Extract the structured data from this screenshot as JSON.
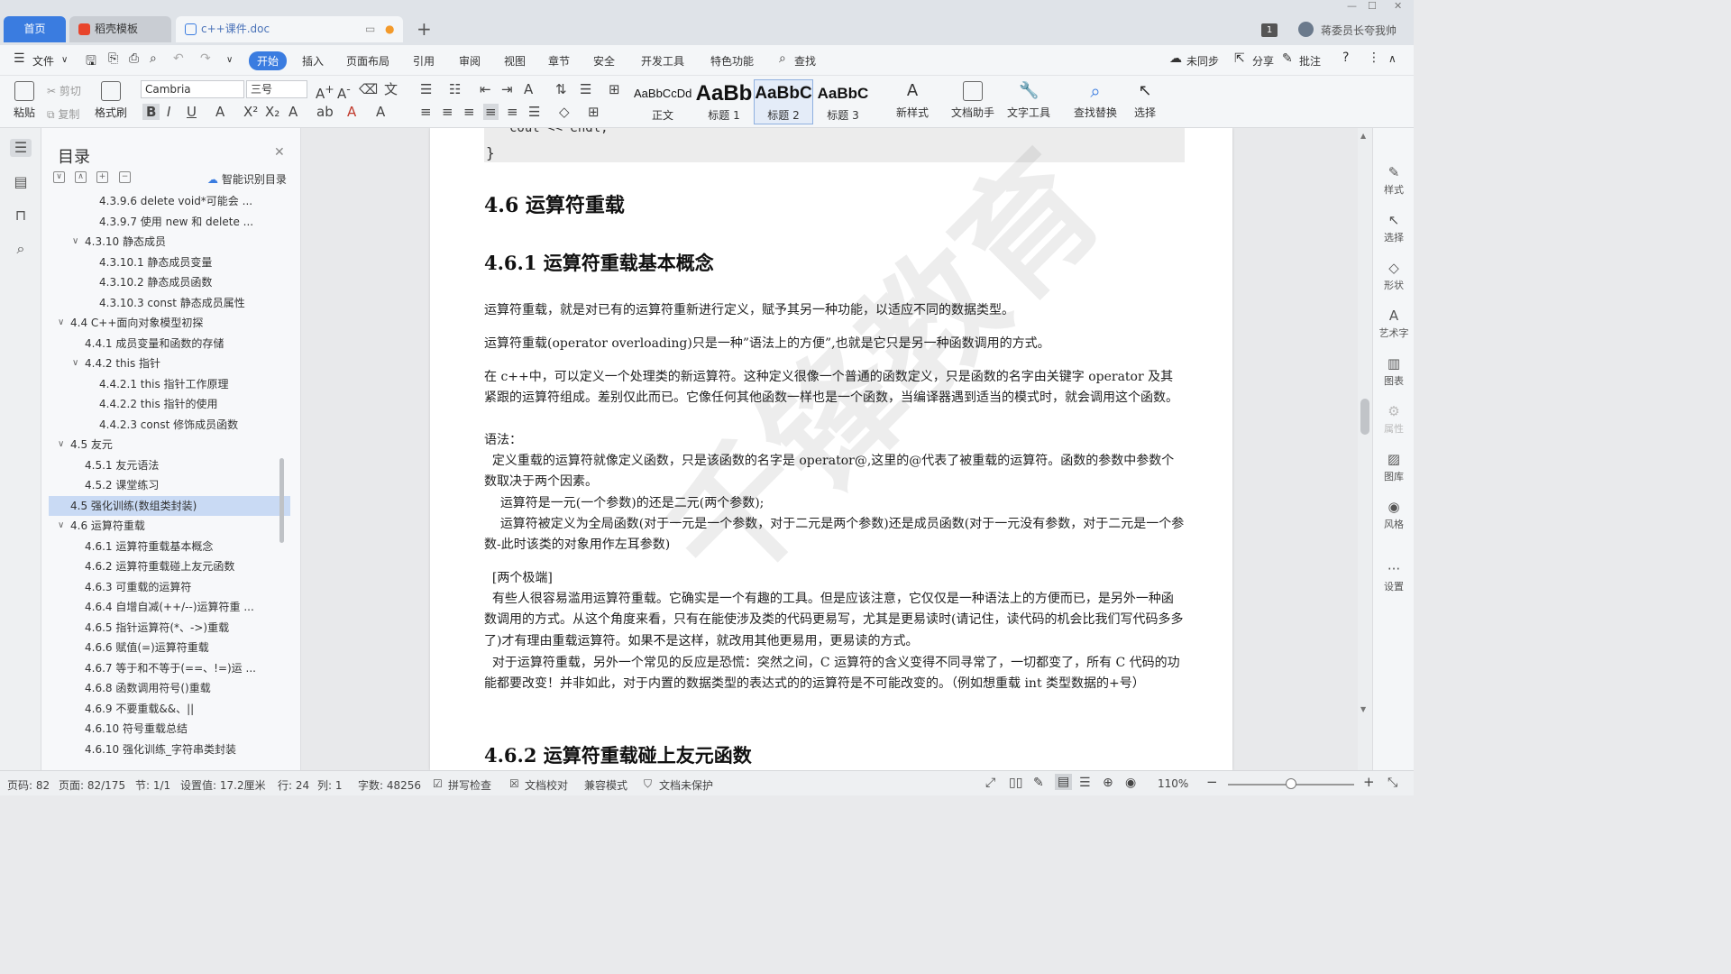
{
  "tabs": {
    "home": "首页",
    "template": "稻壳模板",
    "document": "c++课件.doc"
  },
  "titlebar": {
    "user": "蒋委员长夸我帅",
    "badge": "1"
  },
  "menu": {
    "file": "文件",
    "items": [
      "开始",
      "插入",
      "页面布局",
      "引用",
      "审阅",
      "视图",
      "章节",
      "安全",
      "开发工具",
      "特色功能"
    ],
    "search": "查找",
    "right": [
      "未同步",
      "分享",
      "批注"
    ]
  },
  "ribbon": {
    "paste": "粘贴",
    "cut": "剪切",
    "copy": "复制",
    "format_painter": "格式刷",
    "font_name": "Cambria",
    "font_size": "三号",
    "styles": [
      {
        "preview": "AaBbCcDd",
        "label": "正文"
      },
      {
        "preview": "AaBb",
        "label": "标题 1"
      },
      {
        "preview": "AaBbC",
        "label": "标题 2"
      },
      {
        "preview": "AaBbC",
        "label": "标题 3"
      }
    ],
    "new_style": "新样式",
    "doc_assistant": "文档助手",
    "text_tools": "文字工具",
    "find_replace": "查找替换",
    "select": "选择"
  },
  "toc": {
    "title": "目录",
    "smart": "智能识别目录",
    "items": [
      {
        "text": "4.3.9.6 delete void*可能会 ...",
        "indent": 3,
        "toggle": ""
      },
      {
        "text": "4.3.9.7 使用 new 和 delete ...",
        "indent": 3,
        "toggle": ""
      },
      {
        "text": "4.3.10 静态成员",
        "indent": 2,
        "toggle": "∨"
      },
      {
        "text": "4.3.10.1 静态成员变量",
        "indent": 3,
        "toggle": ""
      },
      {
        "text": "4.3.10.2 静态成员函数",
        "indent": 3,
        "toggle": ""
      },
      {
        "text": "4.3.10.3 const 静态成员属性",
        "indent": 3,
        "toggle": ""
      },
      {
        "text": "4.4 C++面向对象模型初探",
        "indent": 1,
        "toggle": "∨"
      },
      {
        "text": "4.4.1 成员变量和函数的存储",
        "indent": 2,
        "toggle": ""
      },
      {
        "text": "4.4.2 this 指针",
        "indent": 2,
        "toggle": "∨"
      },
      {
        "text": "4.4.2.1 this 指针工作原理",
        "indent": 3,
        "toggle": ""
      },
      {
        "text": "4.4.2.2 this 指针的使用",
        "indent": 3,
        "toggle": ""
      },
      {
        "text": "4.4.2.3 const 修饰成员函数",
        "indent": 3,
        "toggle": ""
      },
      {
        "text": "4.5 友元",
        "indent": 1,
        "toggle": "∨"
      },
      {
        "text": "4.5.1 友元语法",
        "indent": 2,
        "toggle": ""
      },
      {
        "text": "4.5.2 课堂练习",
        "indent": 2,
        "toggle": ""
      },
      {
        "text": "4.5 强化训练(数组类封装)",
        "indent": 1,
        "toggle": "",
        "selected": true
      },
      {
        "text": "4.6 运算符重载",
        "indent": 1,
        "toggle": "∨"
      },
      {
        "text": "4.6.1 运算符重载基本概念",
        "indent": 2,
        "toggle": ""
      },
      {
        "text": "4.6.2 运算符重载碰上友元函数",
        "indent": 2,
        "toggle": ""
      },
      {
        "text": "4.6.3 可重载的运算符",
        "indent": 2,
        "toggle": ""
      },
      {
        "text": "4.6.4 自增自减(++/--)运算符重 ...",
        "indent": 2,
        "toggle": ""
      },
      {
        "text": "4.6.5 指针运算符(*、->)重载",
        "indent": 2,
        "toggle": ""
      },
      {
        "text": "4.6.6 赋值(=)运算符重载",
        "indent": 2,
        "toggle": ""
      },
      {
        "text": "4.6.7 等于和不等于(==、!=)运 ...",
        "indent": 2,
        "toggle": ""
      },
      {
        "text": "4.6.8 函数调用符号()重载",
        "indent": 2,
        "toggle": ""
      },
      {
        "text": "4.6.9 不要重载&&、||",
        "indent": 2,
        "toggle": ""
      },
      {
        "text": "4.6.10 符号重载总结",
        "indent": 2,
        "toggle": ""
      },
      {
        "text": "4.6.10 强化训练_字符串类封装",
        "indent": 2,
        "toggle": ""
      }
    ]
  },
  "doc": {
    "code_line1": "cout << endl;",
    "code_line2": "}",
    "h1": "4.6  运算符重载",
    "h2a": "4.6.1  运算符重载基本概念",
    "p1": "运算符重载，就是对已有的运算符重新进行定义，赋予其另一种功能，以适应不同的数据类型。",
    "p2": "运算符重载(operator overloading)只是一种”语法上的方便”,也就是它只是另一种函数调用的方式。",
    "p3": "在 c++中，可以定义一个处理类的新运算符。这种定义很像一个普通的函数定义，只是函数的名字由关键字 operator 及其紧跟的运算符组成。差别仅此而已。它像任何其他函数一样也是一个函数，当编译器遇到适当的模式时，就会调用这个函数。",
    "p4": "语法：",
    "p5": "  定义重载的运算符就像定义函数，只是该函数的名字是 operator@,这里的@代表了被重载的运算符。函数的参数中参数个数取决于两个因素。",
    "p6": "    运算符是一元(一个参数)的还是二元(两个参数);",
    "p7": "    运算符被定义为全局函数(对于一元是一个参数，对于二元是两个参数)还是成员函数(对于一元没有参数，对于二元是一个参数-此时该类的对象用作左耳参数)",
    "p8": "  [两个极端]",
    "p9": "  有些人很容易滥用运算符重载。它确实是一个有趣的工具。但是应该注意，它仅仅是一种语法上的方便而已，是另外一种函数调用的方式。从这个角度来看，只有在能使涉及类的代码更易写，尤其是更易读时(请记住，读代码的机会比我们写代码多多了)才有理由重载运算符。如果不是这样，就改用其他更易用，更易读的方式。",
    "p10": "  对于运算符重载，另外一个常见的反应是恐慌：突然之间，C 运算符的含义变得不同寻常了，一切都变了，所有 C 代码的功能都要改变！并非如此，对于内置的数据类型的表达式的的运算符是不可能改变的。（例如想重载 int 类型数据的+号）",
    "h2b": "4.6.2  运算符重载碰上友元函数",
    "watermark": "千锋教育"
  },
  "rightbar": [
    "样式",
    "选择",
    "形状",
    "艺术字",
    "图表",
    "属性",
    "图库",
    "风格",
    "设置"
  ],
  "status": {
    "page_code": "页码: 82",
    "page": "页面: 82/175",
    "section": "节: 1/1",
    "setting": "设置值: 17.2厘米",
    "row": "行: 24",
    "col": "列: 1",
    "words": "字数: 48256",
    "spell": "拼写检查",
    "proof": "文档校对",
    "compat": "兼容模式",
    "protect": "文档未保护",
    "zoom": "110%"
  }
}
